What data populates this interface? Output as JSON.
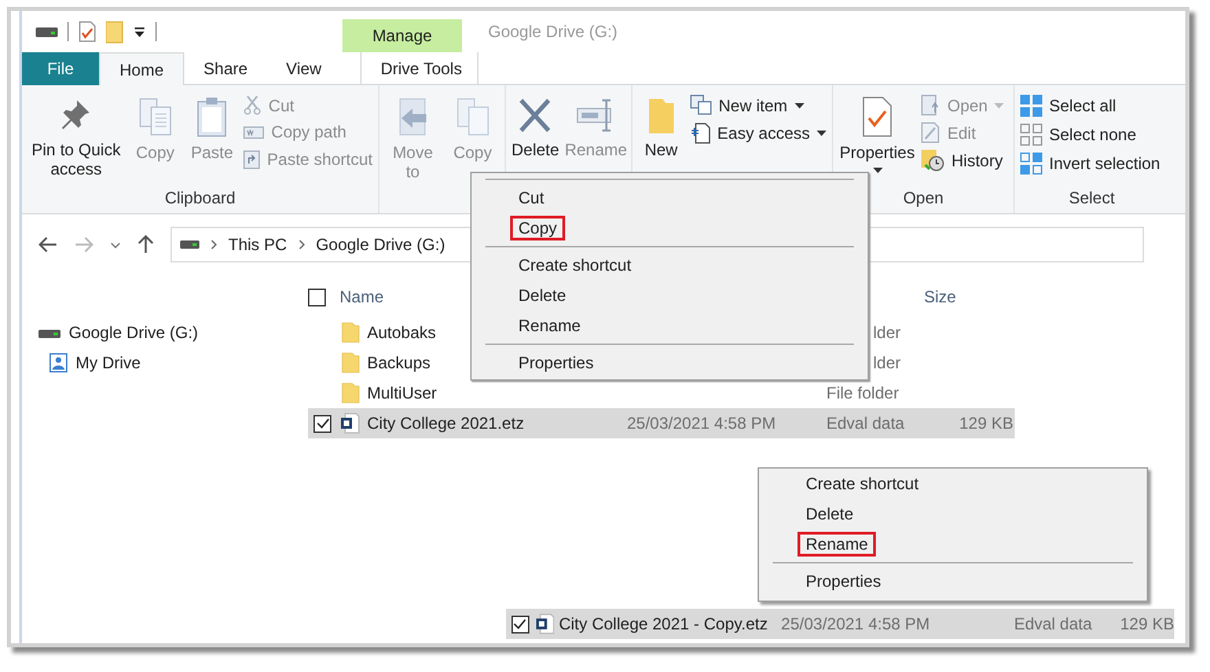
{
  "window": {
    "title": "Google Drive (G:)"
  },
  "contextual_tab": {
    "label": "Manage"
  },
  "tabs": [
    {
      "label": "File",
      "kind": "file",
      "selected": false
    },
    {
      "label": "Home",
      "kind": "tab",
      "selected": true
    },
    {
      "label": "Share",
      "kind": "tab",
      "selected": false
    },
    {
      "label": "View",
      "kind": "tab",
      "selected": false
    },
    {
      "label": "Drive Tools",
      "kind": "tab",
      "selected": false
    }
  ],
  "ribbon": {
    "clipboard": {
      "label": "Clipboard",
      "buttons": [
        {
          "label": "Pin to Quick access",
          "disabled": false
        },
        {
          "label": "Copy",
          "disabled": true
        },
        {
          "label": "Paste",
          "disabled": true
        },
        {
          "label": "Cut",
          "disabled": true
        },
        {
          "label": "Copy path",
          "disabled": true
        },
        {
          "label": "Paste shortcut",
          "disabled": true
        }
      ]
    },
    "organize": {
      "buttons": [
        {
          "label": "Move to",
          "disabled": true
        },
        {
          "label": "Copy",
          "disabled": true
        },
        {
          "label": "Delete",
          "disabled": false
        },
        {
          "label": "Rename",
          "disabled": true
        }
      ]
    },
    "new": {
      "buttons": [
        {
          "label": "New",
          "disabled": false
        },
        {
          "label": "New item",
          "disabled": false
        },
        {
          "label": "Easy access",
          "disabled": false
        }
      ]
    },
    "open": {
      "label": "Open",
      "buttons": [
        {
          "label": "Properties",
          "disabled": false
        },
        {
          "label": "Open",
          "disabled": true
        },
        {
          "label": "Edit",
          "disabled": true
        },
        {
          "label": "History",
          "disabled": false
        }
      ]
    },
    "select": {
      "label": "Select",
      "buttons": [
        {
          "label": "Select all",
          "disabled": false
        },
        {
          "label": "Select none",
          "disabled": false
        },
        {
          "label": "Invert selection",
          "disabled": false
        }
      ]
    }
  },
  "address_bar": {
    "path": [
      "This PC",
      "Google Drive (G:)"
    ]
  },
  "navigation_pane": [
    {
      "label": "Google Drive (G:)"
    },
    {
      "label": "My Drive"
    }
  ],
  "file_list": {
    "columns": [
      {
        "label": "Name"
      },
      {
        "label": "Size"
      }
    ],
    "select_all_checked": false,
    "rows": [
      {
        "name": "Autobaks",
        "type": "lder",
        "selected": false,
        "checked": false
      },
      {
        "name": "Backups",
        "type": "lder",
        "selected": false,
        "checked": false
      },
      {
        "name": "MultiUser",
        "type": "File folder",
        "selected": false,
        "checked": false
      },
      {
        "name": "City College 2021.etz",
        "date": "25/03/2021 4:58 PM",
        "type": "Edval data",
        "size": "129 KB",
        "selected": true,
        "checked": true
      }
    ]
  },
  "context_menu": [
    {
      "label": "Cut",
      "separator_before": true,
      "highlighted": false
    },
    {
      "label": "Copy",
      "separator_before": false,
      "highlighted": true
    },
    {
      "label": "Create shortcut",
      "separator_before": true,
      "highlighted": false
    },
    {
      "label": "Delete",
      "separator_before": false,
      "highlighted": false
    },
    {
      "label": "Rename",
      "separator_before": false,
      "highlighted": false
    },
    {
      "label": "Properties",
      "separator_before": true,
      "highlighted": false
    }
  ],
  "inset_context_menu": [
    {
      "label": "Create shortcut",
      "separator_before": false,
      "highlighted": false
    },
    {
      "label": "Delete",
      "separator_before": false,
      "highlighted": false
    },
    {
      "label": "Rename",
      "separator_before": false,
      "highlighted": true
    },
    {
      "label": "Properties",
      "separator_before": true,
      "highlighted": false
    }
  ],
  "inset_row": {
    "name": "City College 2021 - Copy.etz",
    "date": "25/03/2021 4:58 PM",
    "type": "Edval data",
    "size": "129 KB",
    "selected": true,
    "checked": true
  }
}
